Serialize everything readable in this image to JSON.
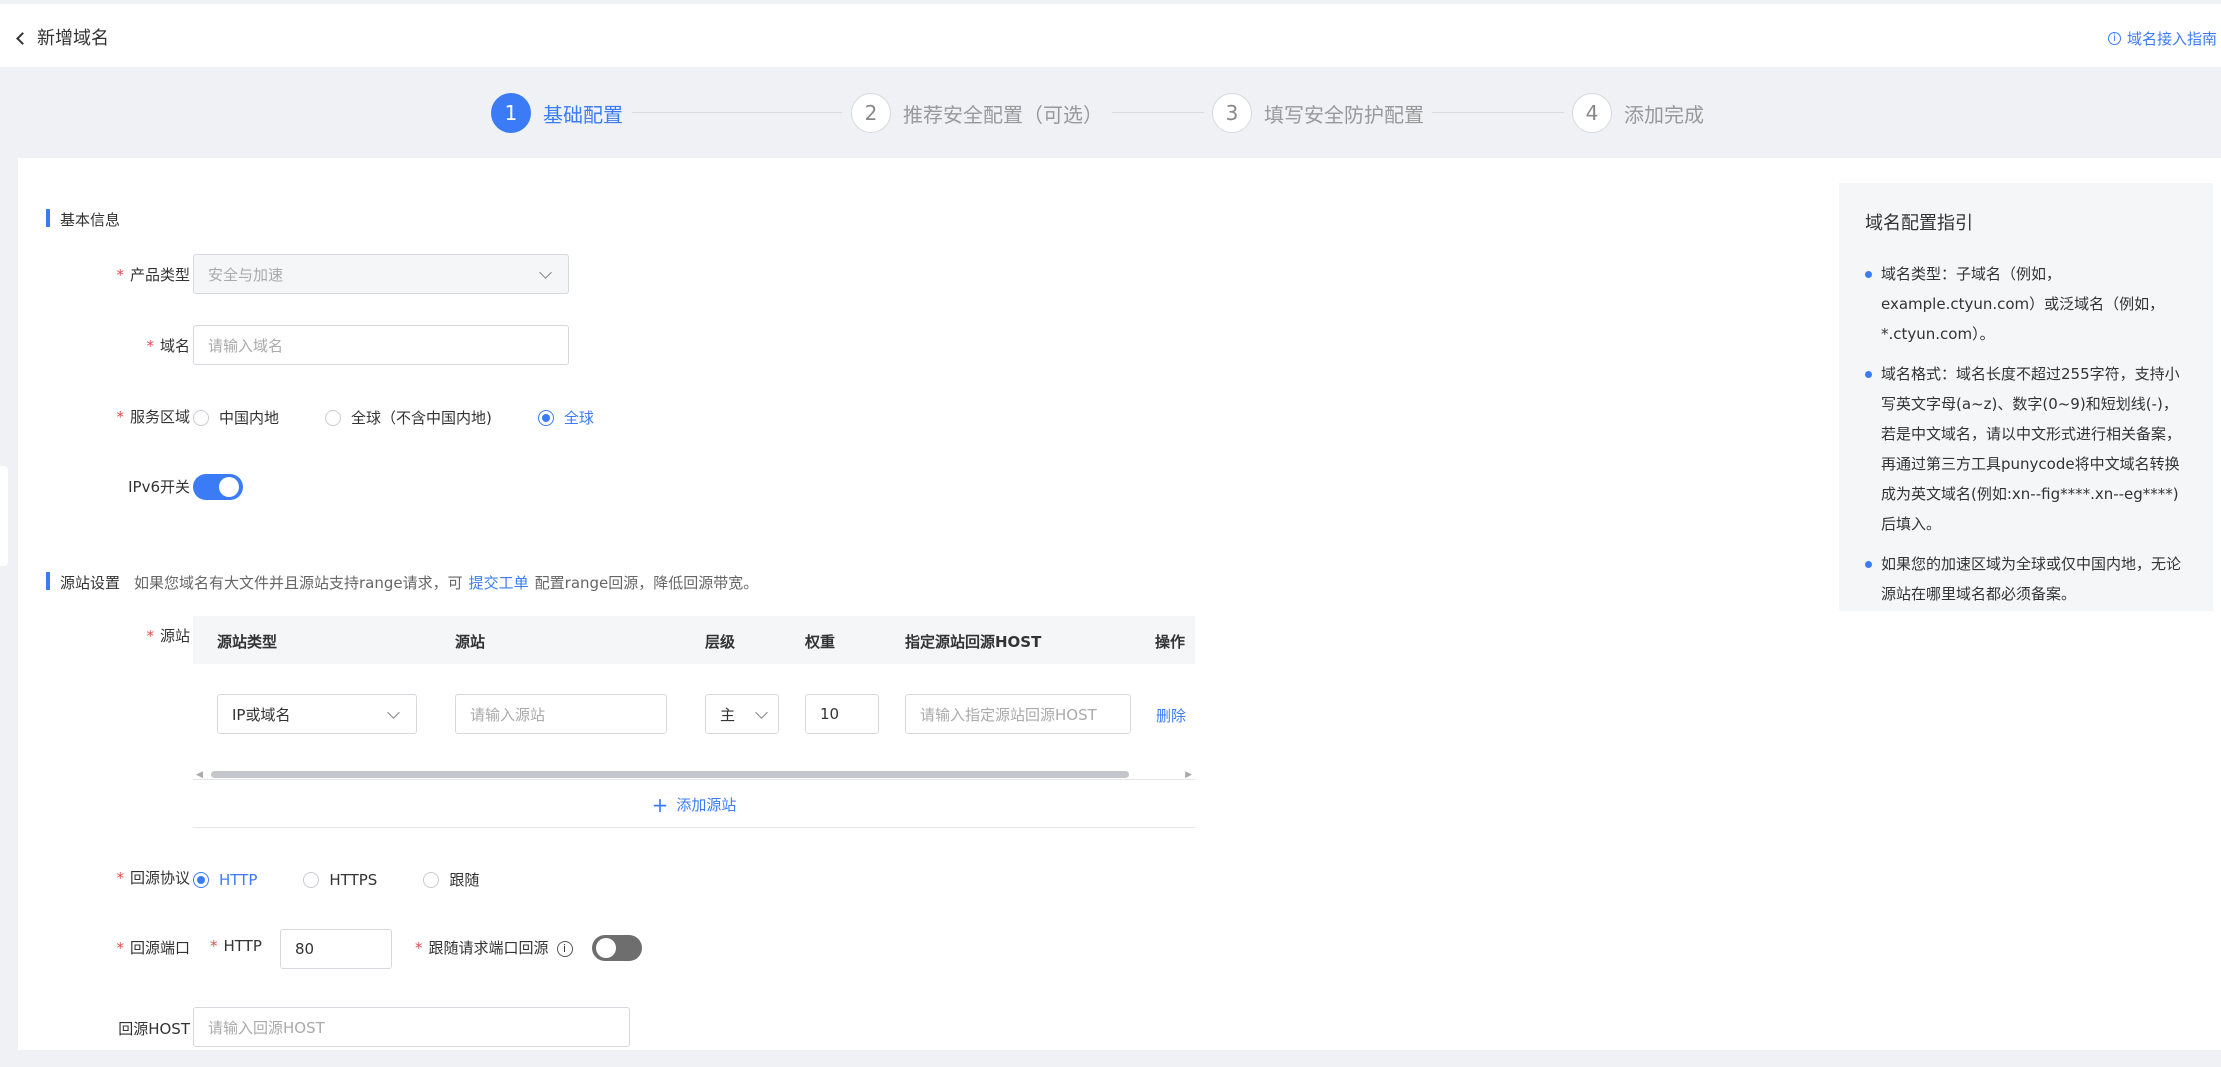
{
  "header": {
    "title": "新增域名",
    "guide_link": "域名接入指南"
  },
  "steps": [
    {
      "num": "1",
      "label": "基础配置"
    },
    {
      "num": "2",
      "label": "推荐安全配置（可选）"
    },
    {
      "num": "3",
      "label": "填写安全防护配置"
    },
    {
      "num": "4",
      "label": "添加完成"
    }
  ],
  "basic": {
    "section_title": "基本信息",
    "product_type": {
      "label": "产品类型",
      "value": "安全与加速"
    },
    "domain": {
      "label": "域名",
      "placeholder": "请输入域名"
    },
    "service_area": {
      "label": "服务区域",
      "options": [
        "中国内地",
        "全球（不含中国内地)",
        "全球"
      ],
      "selected": "全球"
    },
    "ipv6": {
      "label": "IPv6开关",
      "on": true
    }
  },
  "origin": {
    "section_title": "源站设置",
    "note_before": "如果您域名有大文件并且源站支持range请求，可",
    "note_link": "提交工单",
    "note_after": "配置range回源，降低回源带宽。",
    "source_label": "源站",
    "table": {
      "columns": [
        "源站类型",
        "源站",
        "层级",
        "权重",
        "指定源站回源HOST",
        "操作"
      ],
      "row": {
        "type": "IP或域名",
        "source_placeholder": "请输入源站",
        "level": "主",
        "weight": "10",
        "host_placeholder": "请输入指定源站回源HOST",
        "action": "删除"
      },
      "add_label": "添加源站"
    },
    "protocol": {
      "label": "回源协议",
      "options": [
        "HTTP",
        "HTTPS",
        "跟随"
      ],
      "selected": "HTTP"
    },
    "port": {
      "label": "回源端口",
      "http_label": "HTTP",
      "http_value": "80",
      "follow_label": "跟随请求端口回源",
      "follow_on": false
    },
    "host": {
      "label": "回源HOST",
      "placeholder": "请输入回源HOST"
    }
  },
  "guide": {
    "title": "域名配置指引",
    "items": [
      "域名类型：子域名（例如，example.ctyun.com）或泛域名（例如，*.ctyun.com）。",
      "域名格式：域名长度不超过255字符，支持小写英文字母(a~z)、数字(0~9)和短划线(-)，若是中文域名，请以中文形式进行相关备案，再通过第三方工具punycode将中文域名转换成为英文域名(例如:xn--fig****.xn--eg****)后填入。",
      "如果您的加速区域为全球或仅中国内地，无论源站在哪里域名都必须备案。"
    ]
  },
  "colors": {
    "accent": "#3b7cf6",
    "required": "#e34d4d"
  }
}
